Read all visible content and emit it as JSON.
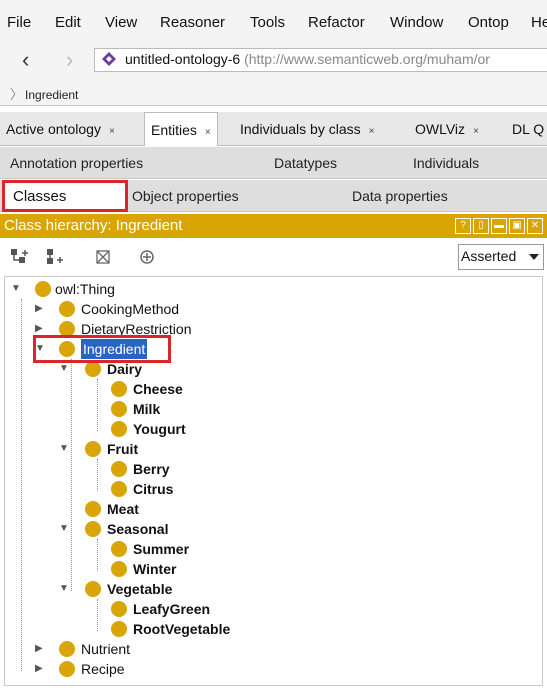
{
  "menu": [
    "File",
    "Edit",
    "View",
    "Reasoner",
    "Tools",
    "Refactor",
    "Window",
    "Ontop",
    "He"
  ],
  "address": {
    "ontology_name": "untitled-ontology-6",
    "ontology_iri": "(http://www.semanticweb.org/muham/or"
  },
  "breadcrumb": "Ingredient",
  "tabs": [
    {
      "label": "Active ontology",
      "close": "×"
    },
    {
      "label": "Entities",
      "close": "×",
      "active": true
    },
    {
      "label": "Individuals by class",
      "close": "×"
    },
    {
      "label": "OWLViz",
      "close": "×"
    },
    {
      "label": "DL Q",
      "close": ""
    }
  ],
  "subtabs_row1": [
    "Annotation properties",
    "Datatypes",
    "Individuals"
  ],
  "subtabs_row2": [
    "Classes",
    "Object properties",
    "Data properties"
  ],
  "hierarchy": {
    "title": "Class hierarchy: Ingredient",
    "win_buttons": [
      "?",
      "▯",
      "▬",
      "▣",
      "✕"
    ],
    "toolbar_icons": [
      "add-subclass-icon",
      "add-sibling-icon",
      "delete-class-icon",
      "target-icon"
    ],
    "view_mode": "Asserted"
  },
  "tree": {
    "root": "owl:Thing",
    "top": [
      "CookingMethod",
      "DietaryRestriction",
      "Ingredient",
      "Nutrient",
      "Recipe"
    ],
    "dairy": "Dairy",
    "dairy_children": [
      "Cheese",
      "Milk",
      "Yougurt"
    ],
    "fruit": "Fruit",
    "fruit_children": [
      "Berry",
      "Citrus"
    ],
    "meat": "Meat",
    "seasonal": "Seasonal",
    "seasonal_children": [
      "Summer",
      "Winter"
    ],
    "vegetable": "Vegetable",
    "vegetable_children": [
      "LeafyGreen",
      "RootVegetable"
    ]
  },
  "colors": {
    "accent": "#d8a505",
    "highlight": "#d9252b",
    "selection": "#2a63c6"
  }
}
